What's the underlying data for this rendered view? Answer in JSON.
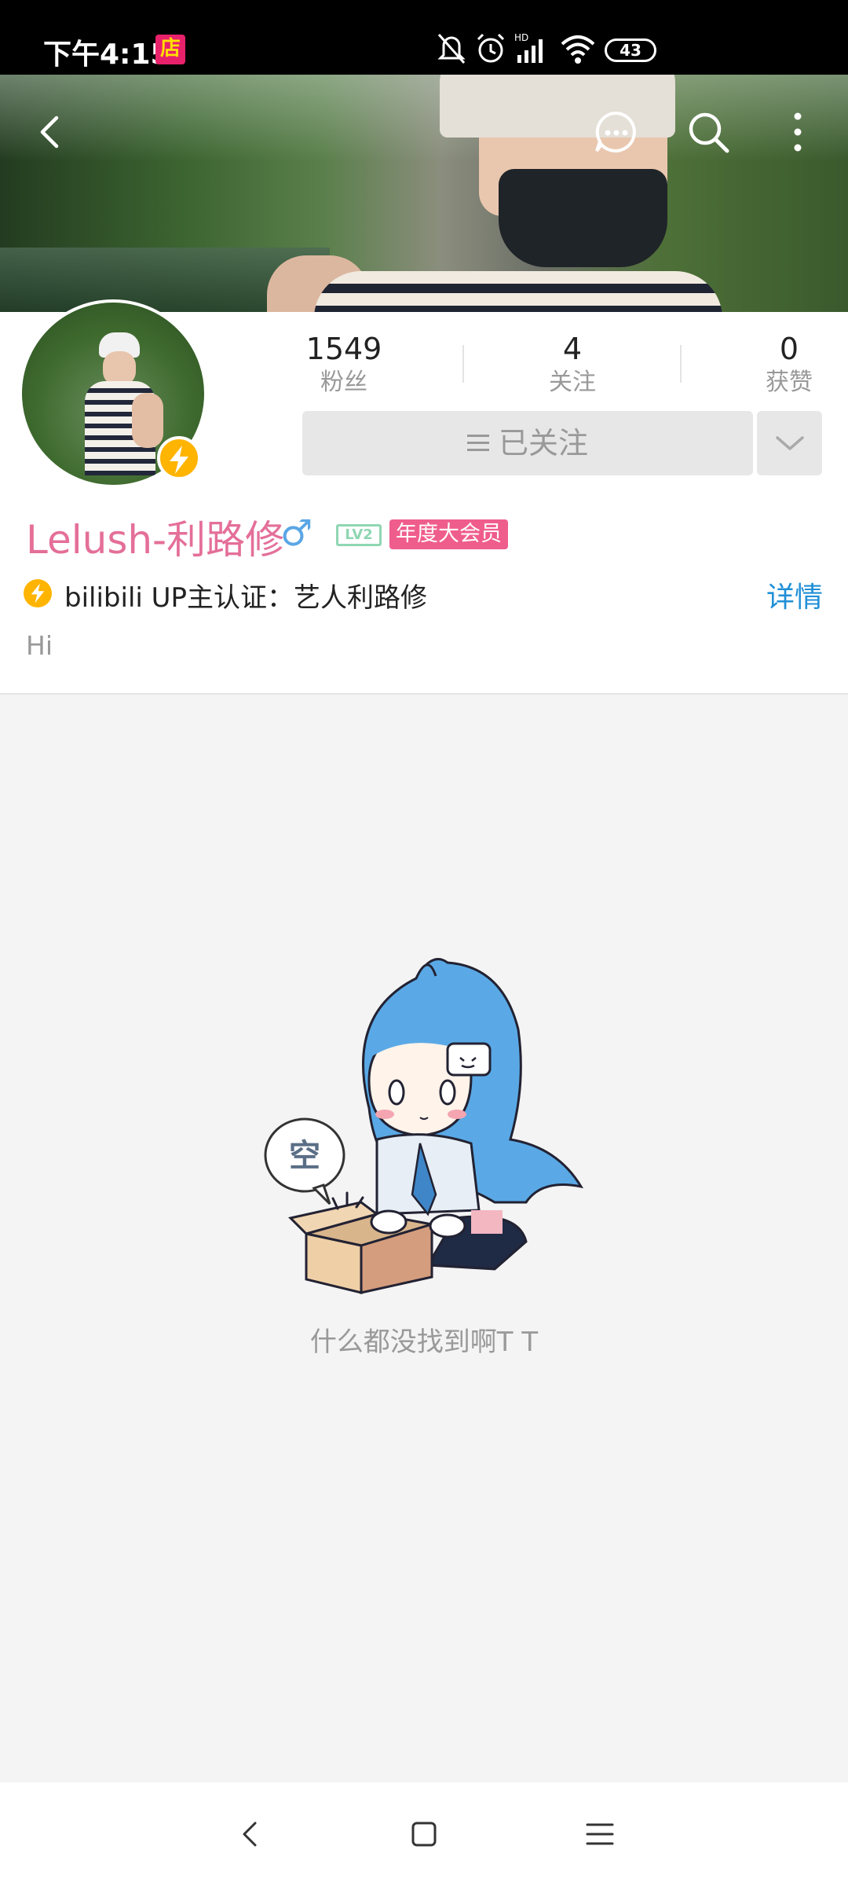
{
  "status_bar": {
    "time": "下午4:15",
    "store_badge": "店",
    "battery": "43"
  },
  "profile": {
    "stats": [
      {
        "value": "1549",
        "label": "粉丝"
      },
      {
        "value": "4",
        "label": "关注"
      },
      {
        "value": "0",
        "label": "获赞"
      }
    ],
    "follow_label": "已关注",
    "name": "Lelush-利路修",
    "gender": "♂",
    "level": "LV2",
    "vip_label": "年度大会员",
    "certification": "bilibili UP主认证：艺人利路修",
    "detail_link": "详情",
    "bio": "Hi"
  },
  "empty_state": {
    "bubble_text": "空",
    "message": "什么都没找到啊T T"
  },
  "colors": {
    "name_pink": "#e46f99",
    "link_blue": "#1f8fd6",
    "vip_pink": "#ef5d8d",
    "level_green": "#8fd6b3",
    "verify_gold": "#ffb400"
  },
  "icons": [
    "back-icon",
    "message-icon",
    "search-icon",
    "more-vert-icon",
    "lightning-icon",
    "chevron-down-icon",
    "nav-back-icon",
    "nav-home-icon",
    "nav-menu-icon"
  ]
}
